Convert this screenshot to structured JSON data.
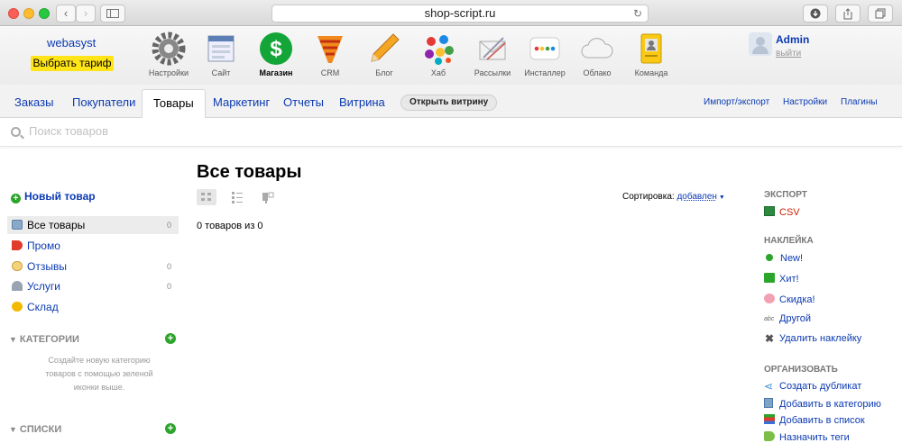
{
  "browser": {
    "url": "shop-script.ru"
  },
  "account": {
    "name": "webasyst",
    "plan_button": "Выбрать тариф"
  },
  "apps": [
    {
      "label": "Настройки"
    },
    {
      "label": "Сайт"
    },
    {
      "label": "Магазин"
    },
    {
      "label": "CRM"
    },
    {
      "label": "Блог"
    },
    {
      "label": "Хаб"
    },
    {
      "label": "Рассылки"
    },
    {
      "label": "Инсталлер"
    },
    {
      "label": "Облако"
    },
    {
      "label": "Команда"
    }
  ],
  "user": {
    "name": "Admin",
    "logout": "выйти"
  },
  "tabs": {
    "main": [
      "Заказы",
      "Покупатели",
      "Товары",
      "Маркетинг",
      "Отчеты",
      "Витрина"
    ],
    "open_storefront": "Открыть витрину",
    "right": [
      "Импорт/экспорт",
      "Настройки",
      "Плагины"
    ]
  },
  "search": {
    "placeholder": "Поиск товаров"
  },
  "sidebar": {
    "new_product": "Новый товар",
    "items": [
      {
        "label": "Все товары",
        "count": "0"
      },
      {
        "label": "Промо",
        "count": ""
      },
      {
        "label": "Отзывы",
        "count": "0"
      },
      {
        "label": "Услуги",
        "count": "0"
      },
      {
        "label": "Склад",
        "count": ""
      }
    ],
    "categories_title": "КАТЕГОРИИ",
    "categories_hint": "Создайте новую категорию товаров с помощью зеленой иконки выше.",
    "lists_title": "СПИСКИ"
  },
  "main": {
    "title": "Все товары",
    "sort_label": "Сортировка:",
    "sort_value": "добавлен",
    "count_text": "0 товаров из 0"
  },
  "right": {
    "export_title": "ЭКСПОРТ",
    "csv": "CSV",
    "badge_title": "НАКЛЕЙКА",
    "badges": [
      "New!",
      "Хит!",
      "Скидка!",
      "Другой",
      "Удалить наклейку"
    ],
    "organize_title": "ОРГАНИЗОВАТЬ",
    "organize": [
      "Создать дубликат",
      "Добавить в категорию",
      "Добавить в список",
      "Назначить теги"
    ]
  },
  "colors": {
    "link": "#0b3ab2",
    "plan_button": "#ffe417",
    "accent_green": "#2ca52c",
    "csv": "#cc2200"
  }
}
